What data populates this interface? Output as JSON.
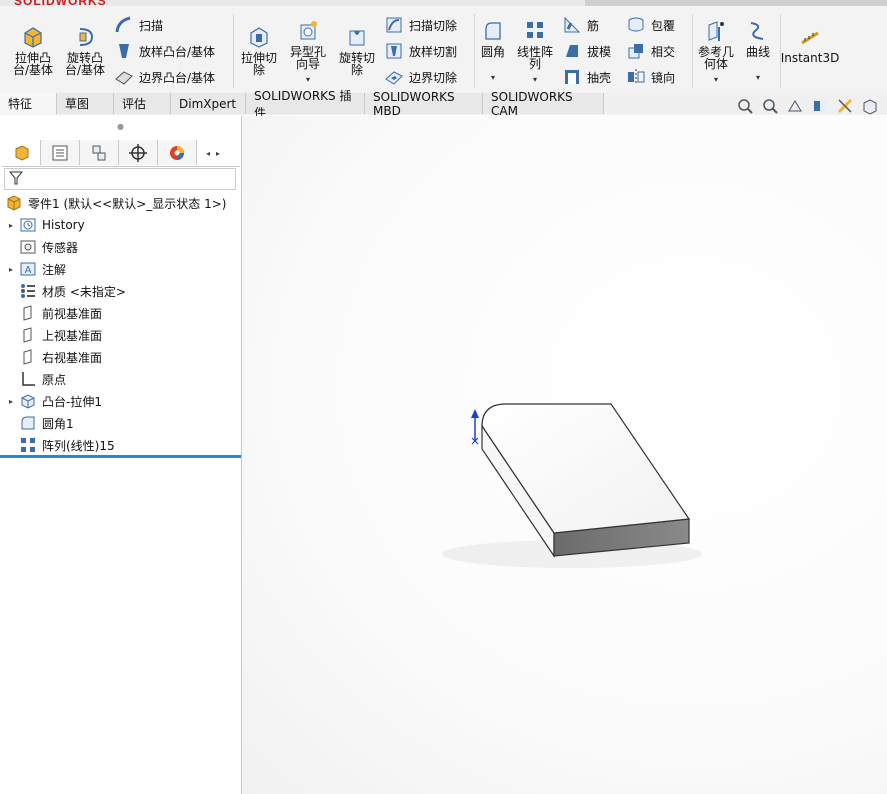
{
  "app": {
    "logo_text": "SOLIDWORKS"
  },
  "ribbon": {
    "extrude_boss": "拉伸凸\n台/基体",
    "revolve_boss": "旋转凸\n台/基体",
    "sweep": "扫描",
    "loft_boss": "放样凸台/基体",
    "boundary_boss": "边界凸台/基体",
    "extrude_cut": "拉伸切\n除",
    "hole_wizard": "异型孔\n向导",
    "revolve_cut": "旋转切\n除",
    "swept_cut": "扫描切除",
    "lofted_cut": "放样切割",
    "boundary_cut": "边界切除",
    "fillet": "圆角",
    "linear_pattern": "线性阵\n列",
    "rib": "筋",
    "draft": "拔模",
    "shell": "抽壳",
    "wrap": "包覆",
    "intersect": "相交",
    "mirror": "镜向",
    "ref_geometry": "参考几\n何体",
    "curves": "曲线",
    "instant3d": "Instant3D"
  },
  "tabs": [
    "特征",
    "草图",
    "评估",
    "DimXpert",
    "SOLIDWORKS 插件",
    "SOLIDWORKS MBD",
    "SOLIDWORKS CAM"
  ],
  "tree": {
    "root": "零件1  (默认<<默认>_显示状态 1>)",
    "items": [
      {
        "label": "History",
        "icon": "history-icon",
        "expandable": true
      },
      {
        "label": "传感器",
        "icon": "sensor-icon",
        "expandable": false
      },
      {
        "label": "注解",
        "icon": "annotation-icon",
        "expandable": true
      },
      {
        "label": "材质 <未指定>",
        "icon": "material-icon",
        "expandable": false
      },
      {
        "label": "前视基准面",
        "icon": "plane-icon",
        "expandable": false
      },
      {
        "label": "上视基准面",
        "icon": "plane-icon",
        "expandable": false
      },
      {
        "label": "右视基准面",
        "icon": "plane-icon",
        "expandable": false
      },
      {
        "label": "原点",
        "icon": "origin-icon",
        "expandable": false
      },
      {
        "label": "凸台-拉伸1",
        "icon": "extrude-icon",
        "expandable": true
      },
      {
        "label": "圆角1",
        "icon": "fillet-icon",
        "expandable": false
      },
      {
        "label": "阵列(线性)15",
        "icon": "pattern-icon",
        "expandable": false
      }
    ]
  },
  "colors": {
    "rollback_bar": "#2e86d1",
    "brand_red": "#c8201e",
    "icon_blue": "#3b6ea8",
    "icon_yellow": "#f1b533"
  }
}
